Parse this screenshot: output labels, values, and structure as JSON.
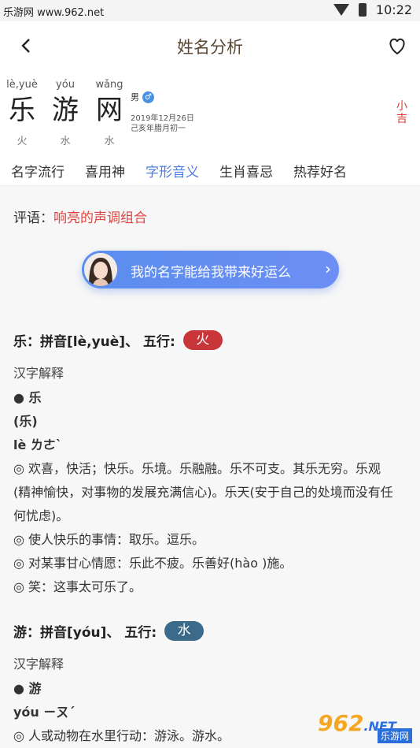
{
  "status": {
    "site": "乐游网 www.962.net",
    "time": "10:22"
  },
  "header": {
    "title": "姓名分析"
  },
  "name": {
    "chars": [
      {
        "pinyin": "lè,yuè",
        "hanzi": "乐",
        "wuxing": "火"
      },
      {
        "pinyin": "yóu",
        "hanzi": "游",
        "wuxing": "水"
      },
      {
        "pinyin": "wǎng",
        "hanzi": "网",
        "wuxing": "水"
      }
    ],
    "gender": "男",
    "birth_solar": "2019年12月26日",
    "birth_lunar": "己亥年腊月初一",
    "side_tag": "小吉"
  },
  "tabs": [
    {
      "label": "名字流行"
    },
    {
      "label": "喜用神"
    },
    {
      "label": "字形音义"
    },
    {
      "label": "生肖喜忌"
    },
    {
      "label": "热荐好名"
    }
  ],
  "active_tab": "字形音义",
  "comment": {
    "label": "评语：",
    "value": "响亮的声调组合"
  },
  "cta": {
    "text": "我的名字能给我带来好运么",
    "arrow": "›"
  },
  "sections": [
    {
      "head": "乐：拼音[lè,yuè]、 五行:",
      "wuxing": "火",
      "color": "#c9363a",
      "sub": "汉字解释",
      "lines": [
        "● 乐",
        "(乐)",
        "lè ㄌㄜˋ",
        "◎ 欢喜，快活；快乐。乐境。乐融融。乐不可支。其乐无穷。乐观",
        "(精神愉快，对事物的发展充满信心)。乐天(安于自己的处境而没有任",
        "何忧虑)。",
        "◎ 使人快乐的事情：取乐。逗乐。",
        "◎ 对某事甘心情愿：乐此不疲。乐善好(hào )施。",
        "◎ 笑：这事太可乐了。"
      ]
    },
    {
      "head": "游：拼音[yóu]、 五行:",
      "wuxing": "水",
      "color": "#3b6a8a",
      "sub": "汉字解释",
      "lines": [
        "● 游",
        "yóu ㄧㄡˊ",
        "◎ 人或动物在水里行动：游泳。游水。"
      ]
    }
  ],
  "watermark": {
    "big": "962",
    "small": "乐游网",
    "mid": ".NET"
  }
}
